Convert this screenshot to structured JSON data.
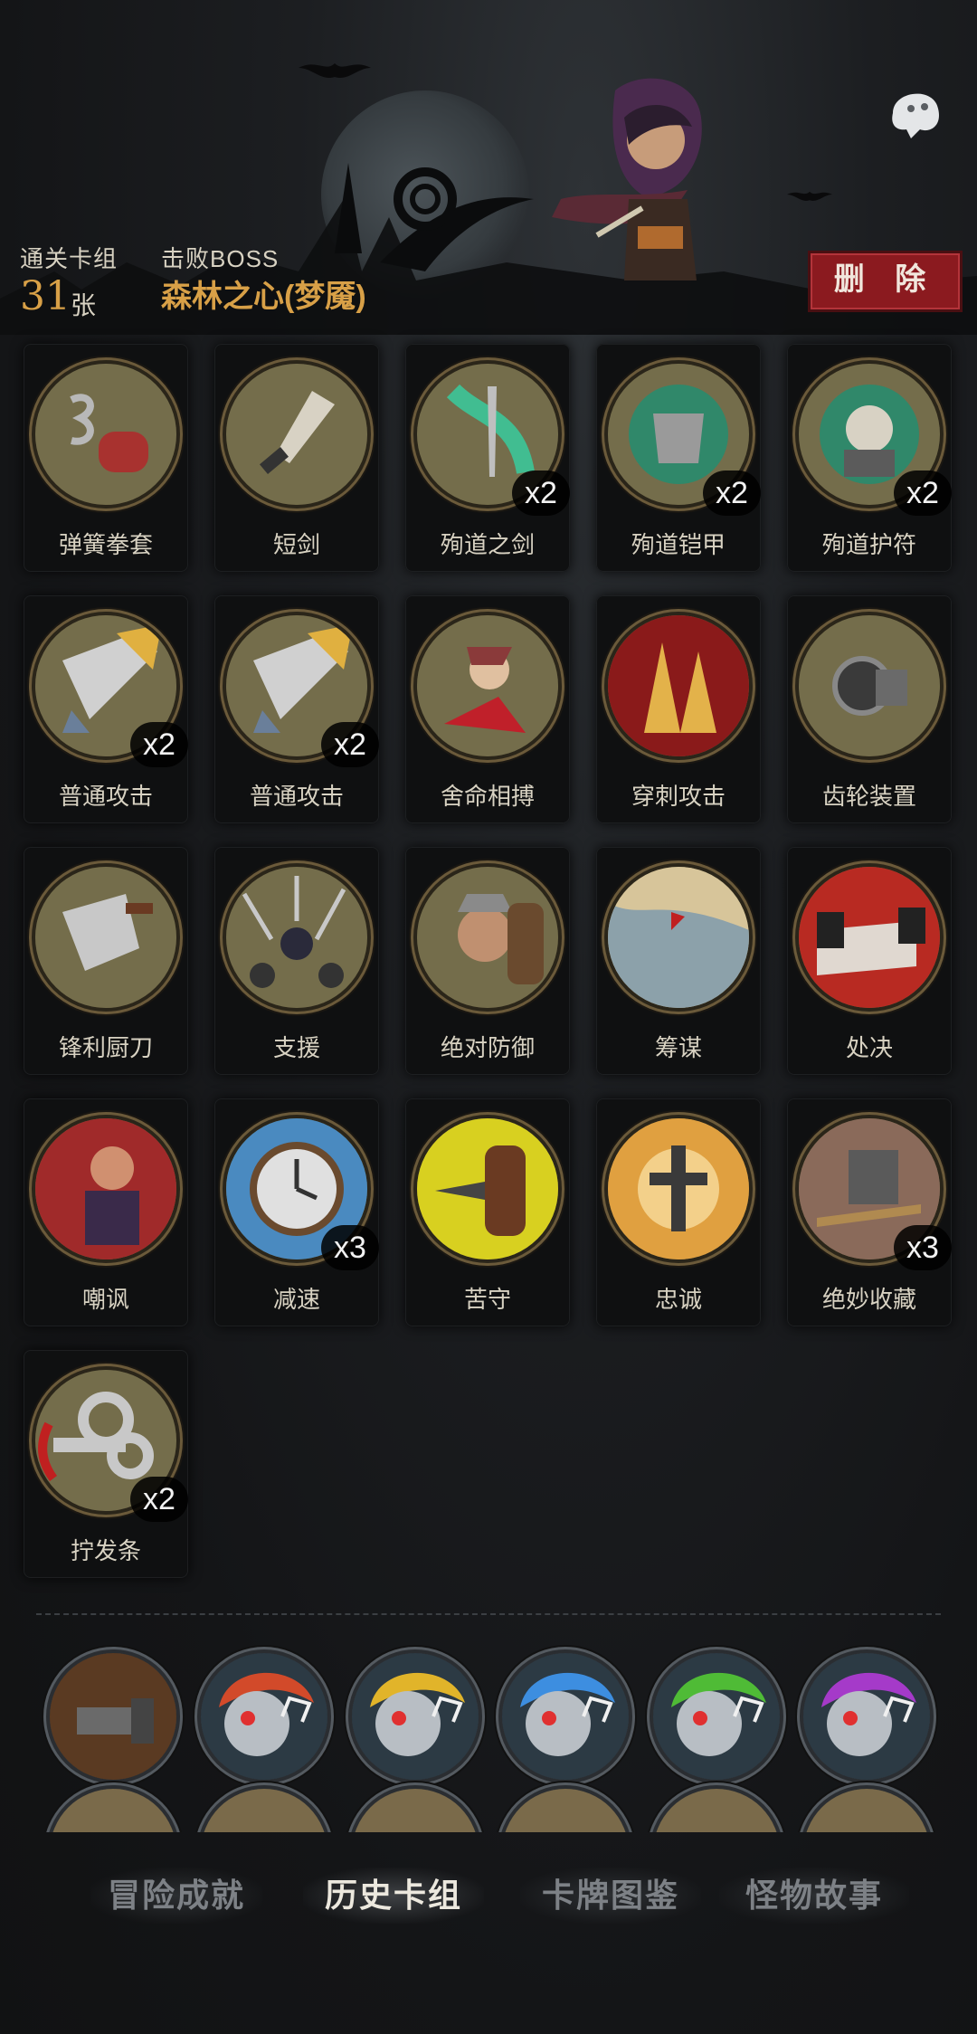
{
  "header": {
    "cleared_deck_label": "通关卡组",
    "card_count": "31",
    "card_unit": "张",
    "boss_label": "击败BOSS",
    "boss_name": "森林之心(梦魇)",
    "delete_label": "删 除"
  },
  "cards": [
    {
      "name": "弹簧拳套",
      "mult": "",
      "icon": "spring-glove-icon"
    },
    {
      "name": "短剑",
      "mult": "",
      "icon": "short-sword-icon"
    },
    {
      "name": "殉道之剑",
      "mult": "x2",
      "icon": "martyr-sword-icon"
    },
    {
      "name": "殉道铠甲",
      "mult": "x2",
      "icon": "martyr-armor-icon"
    },
    {
      "name": "殉道护符",
      "mult": "x2",
      "icon": "martyr-amulet-icon"
    },
    {
      "name": "普通攻击",
      "mult": "x2",
      "icon": "basic-attack-icon"
    },
    {
      "name": "普通攻击",
      "mult": "x2",
      "icon": "basic-attack-icon"
    },
    {
      "name": "舍命相搏",
      "mult": "",
      "icon": "desperate-fight-icon"
    },
    {
      "name": "穿刺攻击",
      "mult": "",
      "icon": "pierce-attack-icon"
    },
    {
      "name": "齿轮装置",
      "mult": "",
      "icon": "gear-device-icon"
    },
    {
      "name": "锋利厨刀",
      "mult": "",
      "icon": "cleaver-icon"
    },
    {
      "name": "支援",
      "mult": "",
      "icon": "support-icon"
    },
    {
      "name": "绝对防御",
      "mult": "",
      "icon": "absolute-defense-icon"
    },
    {
      "name": "筹谋",
      "mult": "",
      "icon": "map-plan-icon"
    },
    {
      "name": "处决",
      "mult": "",
      "icon": "execute-icon"
    },
    {
      "name": "嘲讽",
      "mult": "",
      "icon": "taunt-icon"
    },
    {
      "name": "减速",
      "mult": "x3",
      "icon": "clock-slow-icon"
    },
    {
      "name": "苦守",
      "mult": "",
      "icon": "barrel-guard-icon"
    },
    {
      "name": "忠诚",
      "mult": "",
      "icon": "cross-loyalty-icon"
    },
    {
      "name": "绝妙收藏",
      "mult": "x3",
      "icon": "collection-icon"
    },
    {
      "name": "拧发条",
      "mult": "x2",
      "icon": "wind-key-icon"
    }
  ],
  "relics": [
    {
      "icon": "cannon-relic-icon",
      "color": "#7a4d2c"
    },
    {
      "icon": "singing-skull-red-icon",
      "color": "#d24a2a"
    },
    {
      "icon": "singing-skull-yellow-icon",
      "color": "#e1b42a"
    },
    {
      "icon": "singing-skull-blue-icon",
      "color": "#3d8ee0"
    },
    {
      "icon": "singing-skull-green-icon",
      "color": "#4fbb36"
    },
    {
      "icon": "singing-skull-purple-icon",
      "color": "#a53ac9"
    }
  ],
  "tabs": [
    {
      "label": "冒险成就",
      "active": false
    },
    {
      "label": "历史卡组",
      "active": true
    },
    {
      "label": "卡牌图鉴",
      "active": false
    },
    {
      "label": "怪物故事",
      "active": false
    }
  ]
}
